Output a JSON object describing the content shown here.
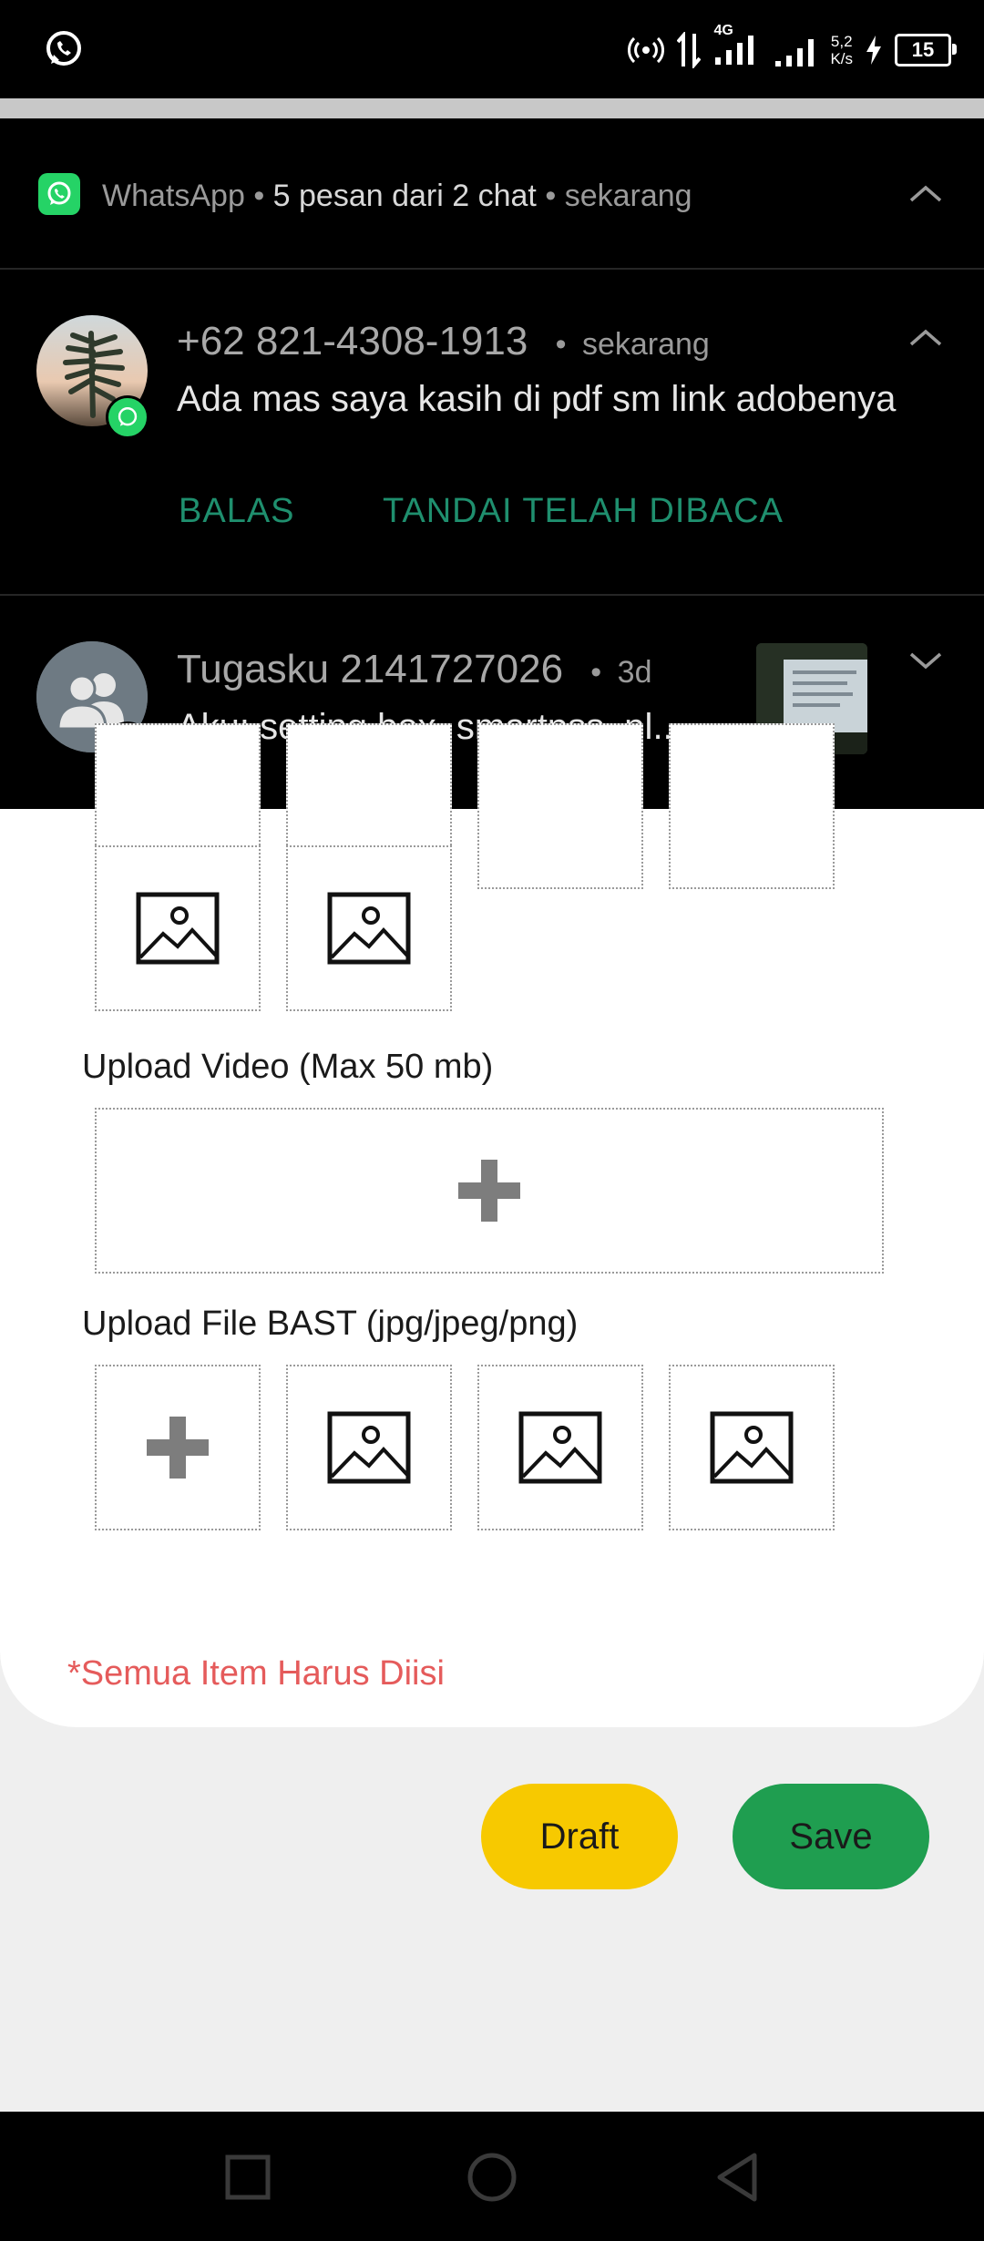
{
  "status_bar": {
    "net_speed_value": "5,2",
    "net_speed_unit": "K/s",
    "network_type": "4G",
    "battery": "15"
  },
  "notification": {
    "app_name": "WhatsApp",
    "summary": "5 pesan dari 2 chat",
    "time": "sekarang",
    "items": [
      {
        "sender": "+62 821-4308-1913",
        "time": "sekarang",
        "message": "Ada mas saya kasih di pdf sm link adobenya",
        "actions": [
          "BALAS",
          "TANDAI TELAH DIBACA"
        ]
      },
      {
        "sender": "Tugasku 2141727026",
        "time": "3d",
        "message": "Aku: setting box, smartpss, pl..."
      }
    ]
  },
  "form": {
    "video_label": "Upload Video (Max 50 mb)",
    "bast_label": "Upload File BAST (jpg/jpeg/png)",
    "required_note": "*Semua Item Harus Diisi"
  },
  "buttons": {
    "draft": "Draft",
    "save": "Save"
  },
  "colors": {
    "accent_green": "#1f9e50",
    "draft_yellow": "#f7c900",
    "whatsapp_green": "#25d366",
    "action_teal": "#1f8f6e",
    "required_red": "#e55b5b"
  }
}
